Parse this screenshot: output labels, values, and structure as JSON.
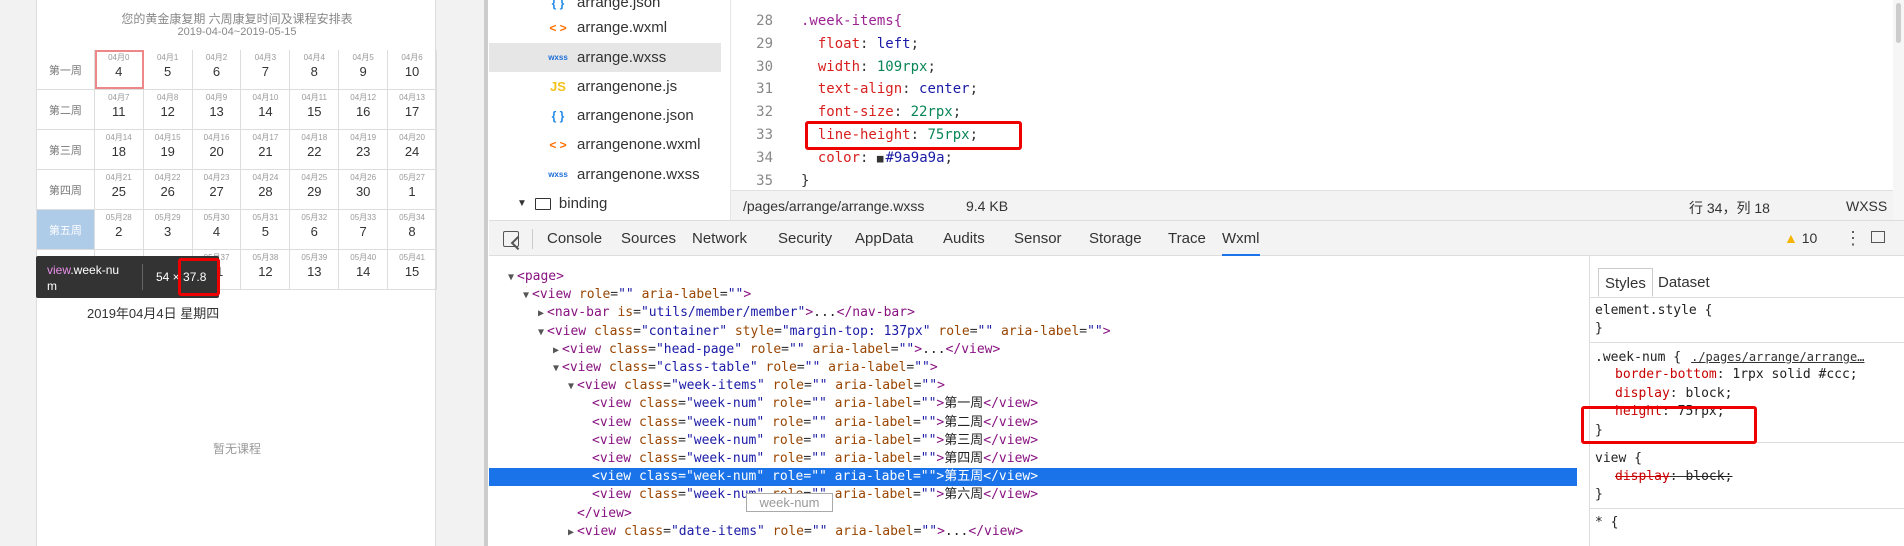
{
  "simulator": {
    "title": "您的黄金康复期 六周康复时间及课程安排表",
    "range": "2019-04-04~2019-05-15",
    "weeks": [
      {
        "label": "第一周",
        "days": [
          [
            "04月0",
            "4"
          ],
          [
            "04月1",
            "5"
          ],
          [
            "04月2",
            "6"
          ],
          [
            "04月3",
            "7"
          ],
          [
            "04月4",
            "8"
          ],
          [
            "04月5",
            "9"
          ],
          [
            "04月6",
            "10"
          ]
        ]
      },
      {
        "label": "第二周",
        "days": [
          [
            "04月7",
            "11"
          ],
          [
            "04月8",
            "12"
          ],
          [
            "04月9",
            "13"
          ],
          [
            "04月10",
            "14"
          ],
          [
            "04月11",
            "15"
          ],
          [
            "04月12",
            "16"
          ],
          [
            "04月13",
            "17"
          ]
        ]
      },
      {
        "label": "第三周",
        "days": [
          [
            "04月14",
            "18"
          ],
          [
            "04月15",
            "19"
          ],
          [
            "04月16",
            "20"
          ],
          [
            "04月17",
            "21"
          ],
          [
            "04月18",
            "22"
          ],
          [
            "04月19",
            "23"
          ],
          [
            "04月20",
            "24"
          ]
        ]
      },
      {
        "label": "第四周",
        "days": [
          [
            "04月21",
            "25"
          ],
          [
            "04月22",
            "26"
          ],
          [
            "04月23",
            "27"
          ],
          [
            "04月24",
            "28"
          ],
          [
            "04月25",
            "29"
          ],
          [
            "04月26",
            "30"
          ],
          [
            "05月27",
            "1"
          ]
        ]
      },
      {
        "label": "第五周",
        "days": [
          [
            "05月28",
            "2"
          ],
          [
            "05月29",
            "3"
          ],
          [
            "05月30",
            "4"
          ],
          [
            "05月31",
            "5"
          ],
          [
            "05月32",
            "6"
          ],
          [
            "05月33",
            "7"
          ],
          [
            "05月34",
            "8"
          ]
        ]
      },
      {
        "label": "",
        "days": [
          [
            "",
            "9"
          ],
          [
            "",
            "10"
          ],
          [
            "05月37",
            "11"
          ],
          [
            "05月38",
            "12"
          ],
          [
            "05月39",
            "13"
          ],
          [
            "05月40",
            "14"
          ],
          [
            "05月41",
            "15"
          ]
        ]
      }
    ],
    "tooltip_name_a": "view",
    "tooltip_name_b": ".week-nu",
    "tooltip_name_c": "m",
    "tooltip_w": "54 ×",
    "tooltip_h": "37.8",
    "current_date": "2019年04月4日 星期四",
    "no_course": "暂无课程"
  },
  "file_tree": {
    "items": [
      {
        "icon": "{ }",
        "type": "json",
        "name": "arrange.json"
      },
      {
        "icon": "< >",
        "type": "wxml",
        "name": "arrange.wxml"
      },
      {
        "icon": "wxss",
        "type": "wxss",
        "name": "arrange.wxss",
        "selected": true
      },
      {
        "icon": "JS",
        "type": "js",
        "name": "arrangenone.js"
      },
      {
        "icon": "{ }",
        "type": "json",
        "name": "arrangenone.json"
      },
      {
        "icon": "< >",
        "type": "wxml",
        "name": "arrangenone.wxml"
      },
      {
        "icon": "wxss",
        "type": "wxss",
        "name": "arrangenone.wxss"
      }
    ],
    "folder": "binding"
  },
  "editor": {
    "lines": [
      {
        "n": "28",
        "parts": [
          [
            ".week-items{",
            "c-sel"
          ]
        ]
      },
      {
        "n": "29",
        "parts": [
          [
            "  float",
            "c-prop"
          ],
          [
            ": ",
            "c-punc"
          ],
          [
            "left",
            "c-val"
          ],
          [
            ";",
            "c-punc"
          ]
        ]
      },
      {
        "n": "30",
        "parts": [
          [
            "  width",
            "c-prop"
          ],
          [
            ": ",
            "c-punc"
          ],
          [
            "109rpx",
            "c-num"
          ],
          [
            ";",
            "c-punc"
          ]
        ]
      },
      {
        "n": "31",
        "parts": [
          [
            "  text-align",
            "c-prop"
          ],
          [
            ": ",
            "c-punc"
          ],
          [
            "center",
            "c-val"
          ],
          [
            ";",
            "c-punc"
          ]
        ]
      },
      {
        "n": "32",
        "parts": [
          [
            "  font-size",
            "c-prop"
          ],
          [
            ": ",
            "c-punc"
          ],
          [
            "22rpx",
            "c-num"
          ],
          [
            ";",
            "c-punc"
          ]
        ]
      },
      {
        "n": "33",
        "parts": [
          [
            "  line-height",
            "c-prop"
          ],
          [
            ": ",
            "c-punc"
          ],
          [
            "75rpx",
            "c-num"
          ],
          [
            ";",
            "c-punc"
          ]
        ]
      },
      {
        "n": "34",
        "parts": [
          [
            "  color",
            "c-prop"
          ],
          [
            ": ",
            "c-punc"
          ],
          [
            "■",
            "c-punc"
          ],
          [
            "#9a9a9a",
            "c-val"
          ],
          [
            ";",
            "c-punc"
          ]
        ]
      },
      {
        "n": "35",
        "parts": [
          [
            "}",
            "c-punc"
          ]
        ]
      }
    ],
    "status_path": "/pages/arrange/arrange.wxss",
    "status_size": "9.4 KB",
    "status_pos": "行 34，列 18",
    "status_lang": "WXSS"
  },
  "devtools": {
    "tabs": [
      "Console",
      "Sources",
      "Network",
      "Security",
      "AppData",
      "Audits",
      "Sensor",
      "Storage",
      "Trace",
      "Wxml"
    ],
    "active_tab": "Wxml",
    "warning_count": "10",
    "hover_label": "week-num"
  },
  "wxml_lines": [
    {
      "indent": 0,
      "arrow": "▼",
      "html": "<page>"
    },
    {
      "indent": 1,
      "arrow": "▼",
      "html": "<view role=\"\" aria-label=\"\">"
    },
    {
      "indent": 2,
      "arrow": "▶",
      "html": "<nav-bar is=\"utils/member/member\">...</nav-bar>"
    },
    {
      "indent": 2,
      "arrow": "▼",
      "html": "<view class=\"container\" style=\"margin-top: 137px\" role=\"\" aria-label=\"\">"
    },
    {
      "indent": 3,
      "arrow": "▶",
      "html": "<view class=\"head-page\" role=\"\" aria-label=\"\">...</view>"
    },
    {
      "indent": 3,
      "arrow": "▼",
      "html": "<view class=\"class-table\" role=\"\" aria-label=\"\">"
    },
    {
      "indent": 4,
      "arrow": "▼",
      "html": "<view class=\"week-items\" role=\"\" aria-label=\"\">"
    },
    {
      "indent": 5,
      "arrow": "",
      "html": "<view class=\"week-num\" role=\"\" aria-label=\"\">第一周</view>"
    },
    {
      "indent": 5,
      "arrow": "",
      "html": "<view class=\"week-num\" role=\"\" aria-label=\"\">第二周</view>"
    },
    {
      "indent": 5,
      "arrow": "",
      "html": "<view class=\"week-num\" role=\"\" aria-label=\"\">第三周</view>"
    },
    {
      "indent": 5,
      "arrow": "",
      "html": "<view class=\"week-num\" role=\"\" aria-label=\"\">第四周</view>"
    },
    {
      "indent": 5,
      "arrow": "",
      "html": "<view class=\"week-num\" role=\"\" aria-label=\"\">第五周</view>",
      "selected": true
    },
    {
      "indent": 5,
      "arrow": "",
      "html": "<view class=\"week-num\" role=\"\" aria-label=\"\">第六周</view>"
    },
    {
      "indent": 4,
      "arrow": "",
      "html": "</view>"
    },
    {
      "indent": 4,
      "arrow": "▶",
      "html": "<view class=\"date-items\" role=\"\" aria-label=\"\">...</view>"
    }
  ],
  "styles_panel": {
    "tabs": [
      "Styles",
      "Dataset"
    ],
    "element_style": "element.style {",
    "close": "}",
    "rule_selector": ".week-num {",
    "rule_source": "./pages/arrange/arrange…",
    "rule_props": [
      [
        "border-bottom",
        "1rpx solid #ccc;"
      ],
      [
        "display",
        "block;"
      ],
      [
        "height",
        "75rpx;"
      ]
    ],
    "view_selector": "view {",
    "view_props": [
      [
        "display",
        "block;"
      ]
    ],
    "star_selector": "* {"
  }
}
